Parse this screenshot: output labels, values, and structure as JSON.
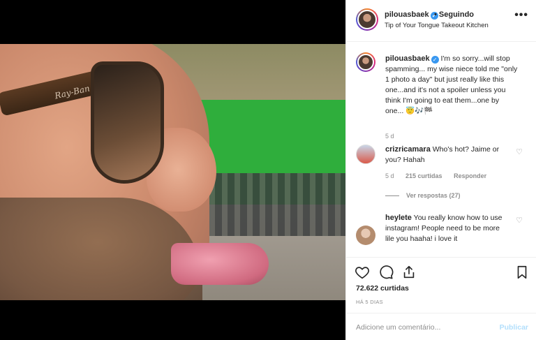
{
  "post": {
    "image_alt": "Close-up selfie with sunglasses, tongue out, green screen set in background",
    "brand_on_glasses": "Ray-Ban"
  },
  "header": {
    "username": "pilouasbaek",
    "follow_label": "• Seguindo",
    "location": "Tip of Your Tongue Takeout Kitchen",
    "more_label": "•••"
  },
  "caption": {
    "username": "pilouasbaek",
    "text": "I'm so sorry...will stop spamming... my wise niece told me \"only 1 photo a day\" but just really like this one...and it's not a spoiler unless you think I'm going to eat them...one by one... 😇🎶🏁",
    "time": "5 d"
  },
  "comments": [
    {
      "username": "crizricamara",
      "text": "Who's hot? Jaime or you? Hahah",
      "time": "5 d",
      "likes": "215 curtidas",
      "reply": "Responder",
      "view_replies": "Ver respostas (27)"
    },
    {
      "username": "heylete",
      "text": "You really know how to use instagram! People need to be more lile you haaha! i love it"
    }
  ],
  "actions": {
    "likes": "72.622 curtidas",
    "date": "HÁ 5 DIAS"
  },
  "add_comment": {
    "placeholder": "Adicione um comentário...",
    "publish": "Publicar"
  }
}
